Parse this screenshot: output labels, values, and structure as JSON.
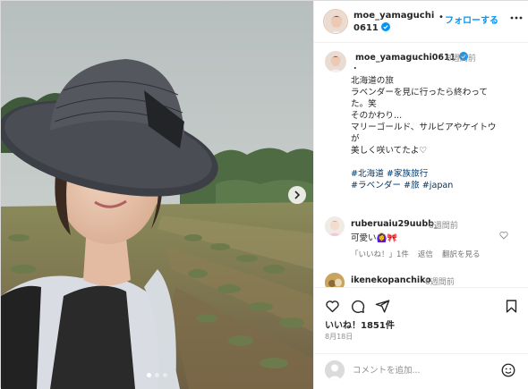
{
  "post": {
    "username": "moe_yamaguchi0611",
    "verified": true,
    "follow_label": "フォローする",
    "separator": "•",
    "caption_user": "moe_yamaguchi0611",
    "caption_time": "8週間前",
    "caption_lines": [
      "・",
      "北海道の旅",
      "ラベンダーを見に行ったら終わって",
      "た。笑",
      "そのかわり...",
      "マリーゴールド、サルビアやケイトウ",
      "が",
      "美しく咲いてたよ♡"
    ],
    "hashtag_lines": [
      "#北海道 #家族旅行",
      "#ラベンダー #旅 #japan"
    ],
    "likes": "いいね！1851件",
    "date": "8月18日"
  },
  "comments": [
    {
      "user": "ruberuaiu29uubb_",
      "time": "8週間前",
      "text": "可愛い🙆‍♀️🎀",
      "likes": "「いいね！」1件",
      "reply": "返信",
      "translate": "翻訳を見る"
    },
    {
      "user": "ikenekopanchiko",
      "time": "8週間前"
    }
  ],
  "composer": {
    "placeholder": "コメントを追加..."
  },
  "carousel": {
    "count": 3,
    "active": 1
  },
  "icons": {
    "verified": "verified-badge-icon",
    "more": "more-options-icon",
    "like": "heart-icon",
    "comment": "comment-icon",
    "share": "paper-plane-icon",
    "save": "bookmark-icon",
    "emoji": "emoji-icon",
    "next": "chevron-right-icon"
  },
  "colors": {
    "accent": "#0095f6",
    "hashtag": "#00376b",
    "muted": "#8e8e8e"
  }
}
